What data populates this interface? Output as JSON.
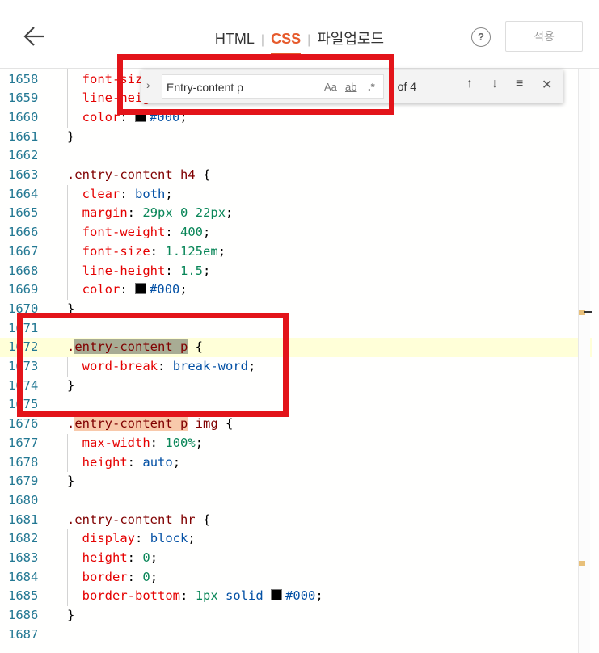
{
  "header": {
    "back_label": "back",
    "tabs": [
      {
        "label": "HTML",
        "active": false
      },
      {
        "label": "CSS",
        "active": true
      },
      {
        "label": "파일업로드",
        "active": false
      }
    ],
    "separator": "|",
    "help_label": "?",
    "apply_label": "적용"
  },
  "find": {
    "query": "Entry-content p",
    "match_case": "Aa",
    "whole_word": "ab",
    "regex": ".*",
    "count": "1 of 4"
  },
  "editor": {
    "lines": [
      {
        "n": "1658",
        "code": "font-siz"
      },
      {
        "n": "1659",
        "code": "line-height: 1.5;"
      },
      {
        "n": "1660",
        "code": "color: #000;"
      },
      {
        "n": "1661",
        "code": "}"
      },
      {
        "n": "1662",
        "code": ""
      },
      {
        "n": "1663",
        "code": ".entry-content h4 {"
      },
      {
        "n": "1664",
        "code": "clear: both;"
      },
      {
        "n": "1665",
        "code": "margin: 29px 0 22px;"
      },
      {
        "n": "1666",
        "code": "font-weight: 400;"
      },
      {
        "n": "1667",
        "code": "font-size: 1.125em;"
      },
      {
        "n": "1668",
        "code": "line-height: 1.5;"
      },
      {
        "n": "1669",
        "code": "color: #000;"
      },
      {
        "n": "1670",
        "code": "}"
      },
      {
        "n": "1671",
        "code": ""
      },
      {
        "n": "1672",
        "code": ".entry-content p {"
      },
      {
        "n": "1673",
        "code": "word-break: break-word;"
      },
      {
        "n": "1674",
        "code": "}"
      },
      {
        "n": "1675",
        "code": ""
      },
      {
        "n": "1676",
        "code": ".entry-content p img {"
      },
      {
        "n": "1677",
        "code": "max-width: 100%;"
      },
      {
        "n": "1678",
        "code": "height: auto;"
      },
      {
        "n": "1679",
        "code": "}"
      },
      {
        "n": "1680",
        "code": ""
      },
      {
        "n": "1681",
        "code": ".entry-content hr {"
      },
      {
        "n": "1682",
        "code": "display: block;"
      },
      {
        "n": "1683",
        "code": "height: 0;"
      },
      {
        "n": "1684",
        "code": "border: 0;"
      },
      {
        "n": "1685",
        "code": "border-bottom: 1px solid #000;"
      },
      {
        "n": "1686",
        "code": "}"
      },
      {
        "n": "1687",
        "code": ""
      }
    ]
  }
}
